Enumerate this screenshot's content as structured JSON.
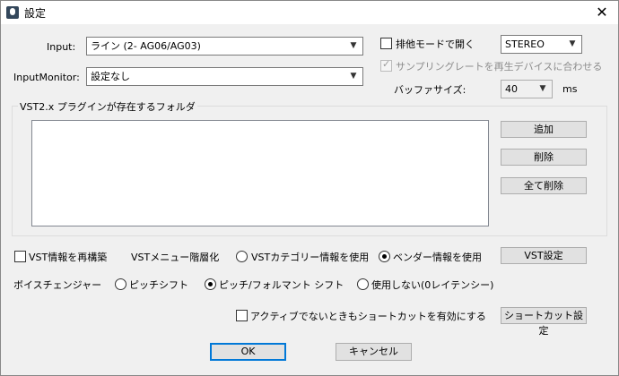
{
  "window": {
    "title": "設定",
    "icon": "microphone-app-icon",
    "close_glyph": "✕"
  },
  "input": {
    "label": "Input:",
    "value": "ライン (2- AG06/AG03)"
  },
  "input_monitor": {
    "label": "InputMonitor:",
    "value": "設定なし"
  },
  "exclusive_mode": {
    "label": "排他モードで開く",
    "checked": false
  },
  "channel_mode": {
    "value": "STEREO"
  },
  "sample_rate": {
    "label": "サンプリングレートを再生デバイスに合わせる",
    "checked": true,
    "enabled": false
  },
  "buffer": {
    "label": "バッファサイズ:",
    "value": "40",
    "unit": "ms"
  },
  "vst_group": {
    "title": "VST2.x プラグインが存在するフォルダ",
    "folders": [],
    "add_label": "追加",
    "delete_label": "削除",
    "delete_all_label": "全て削除"
  },
  "vst_options": {
    "rebuild_label": "VST情報を再構築",
    "rebuild_checked": false,
    "menu_hierarchy_label": "VSTメニュー階層化",
    "category_label": "VSTカテゴリー情報を使用",
    "vendor_label": "ベンダー情報を使用",
    "selected": "vendor",
    "settings_label": "VST設定"
  },
  "voice_changer": {
    "label": "ボイスチェンジャー",
    "pitch_shift_label": "ピッチシフト",
    "pitch_formant_label": "ピッチ/フォルマント シフト",
    "none_label": "使用しない(0レイテンシー)",
    "selected": "pitch_formant"
  },
  "shortcut": {
    "inactive_label": "アクティブでないときもショートカットを有効にする",
    "inactive_checked": false,
    "settings_label": "ショートカット設定"
  },
  "footer": {
    "ok_label": "OK",
    "cancel_label": "キャンセル"
  },
  "colors": {
    "accent": "#0078d7",
    "window_bg": "#f0f0f0"
  }
}
